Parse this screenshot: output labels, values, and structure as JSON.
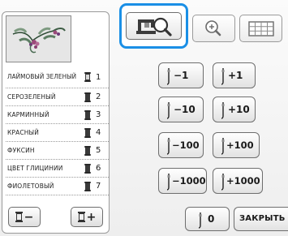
{
  "colors": [
    {
      "name": "ЛАЙМОВЫЙ ЗЕЛЕНЫЙ",
      "number": "1"
    },
    {
      "name": "СЕРОЗЕЛЕНЫЙ",
      "number": "2"
    },
    {
      "name": "КАРМИННЫЙ",
      "number": "3"
    },
    {
      "name": "КРАСНЫЙ",
      "number": "4"
    },
    {
      "name": "ФУКСИН",
      "number": "5"
    },
    {
      "name": "ЦВЕТ ГЛИЦИНИИ",
      "number": "6"
    },
    {
      "name": "ФИОЛЕТОВЫЙ",
      "number": "7"
    }
  ],
  "spool_buttons": {
    "minus": "−",
    "plus": "+"
  },
  "tabs": {
    "view": "view-tab-icon",
    "zoom": "zoom-tab-icon",
    "grid": "grid-tab-icon"
  },
  "density": {
    "minus_1": "−1",
    "plus_1": "+1",
    "minus_10": "−10",
    "plus_10": "+10",
    "minus_100": "−100",
    "plus_100": "+100",
    "minus_1000": "−1000",
    "plus_1000": "+1000"
  },
  "zero_label": "0",
  "close_label": "ЗАКРЫТЬ",
  "accent": "#1a8fe6"
}
